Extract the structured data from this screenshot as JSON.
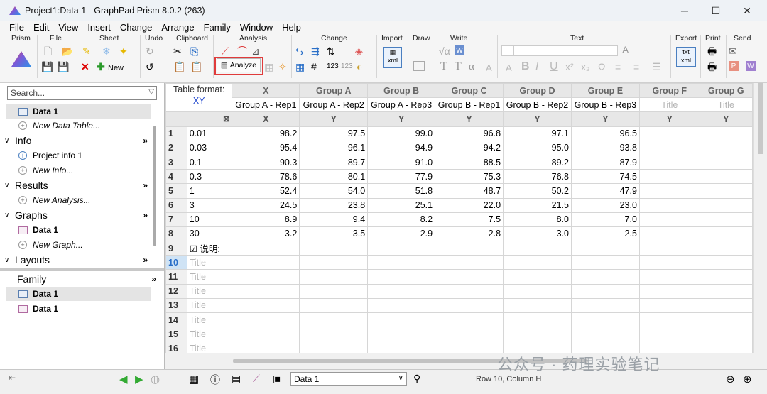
{
  "window": {
    "title": "Project1:Data 1 - GraphPad Prism 8.0.2 (263)",
    "minimize": "─",
    "restore": "☐",
    "close": "✕"
  },
  "menu": [
    "File",
    "Edit",
    "View",
    "Insert",
    "Change",
    "Arrange",
    "Family",
    "Window",
    "Help"
  ],
  "ribbon": {
    "groups": [
      "Prism",
      "File",
      "Sheet",
      "Undo",
      "Clipboard",
      "Analysis",
      "Change",
      "Import",
      "Draw",
      "Write",
      "Text",
      "Export",
      "Print",
      "Send"
    ],
    "new_label": "New",
    "analyze_label": "Analyze"
  },
  "sidebar": {
    "search_placeholder": "Search...",
    "data_tables": [
      {
        "label": "Data 1"
      },
      {
        "label": "New Data Table..."
      }
    ],
    "info": {
      "label": "Info",
      "items": [
        "Project info 1",
        "New Info..."
      ]
    },
    "results": {
      "label": "Results",
      "items": [
        "New Analysis..."
      ]
    },
    "graphs": {
      "label": "Graphs",
      "items": [
        "Data 1",
        "New Graph..."
      ]
    },
    "layouts": {
      "label": "Layouts"
    },
    "family": {
      "label": "Family",
      "items": [
        "Data 1",
        "Data 1"
      ]
    }
  },
  "table": {
    "format_label": "Table format:",
    "format_value": "XY",
    "columns": [
      {
        "letter": "X",
        "title": "Group A - Rep1",
        "sub": "X"
      },
      {
        "letter": "Group A",
        "title": "Group A - Rep2",
        "sub": "Y"
      },
      {
        "letter": "Group B",
        "title": "Group A - Rep3",
        "sub": "Y"
      },
      {
        "letter": "Group C",
        "title": "Group B - Rep1",
        "sub": "Y"
      },
      {
        "letter": "Group D",
        "title": "Group B - Rep2",
        "sub": "Y"
      },
      {
        "letter": "Group E",
        "title": "Group B - Rep3",
        "sub": "Y"
      },
      {
        "letter": "Group F",
        "title": "Title",
        "sub": "Y"
      },
      {
        "letter": "Group G",
        "title": "Title",
        "sub": "Y"
      }
    ],
    "rows": [
      {
        "n": "1",
        "label": "0.01",
        "values": [
          "98.2",
          "97.5",
          "99.0",
          "96.8",
          "97.1",
          "96.5"
        ]
      },
      {
        "n": "2",
        "label": "0.03",
        "values": [
          "95.4",
          "96.1",
          "94.9",
          "94.2",
          "95.0",
          "93.8"
        ]
      },
      {
        "n": "3",
        "label": "0.1",
        "values": [
          "90.3",
          "89.7",
          "91.0",
          "88.5",
          "89.2",
          "87.9"
        ]
      },
      {
        "n": "4",
        "label": "0.3",
        "values": [
          "78.6",
          "80.1",
          "77.9",
          "75.3",
          "76.8",
          "74.5"
        ]
      },
      {
        "n": "5",
        "label": "1",
        "values": [
          "52.4",
          "54.0",
          "51.8",
          "48.7",
          "50.2",
          "47.9"
        ]
      },
      {
        "n": "6",
        "label": "3",
        "values": [
          "24.5",
          "23.8",
          "25.1",
          "22.0",
          "21.5",
          "23.0"
        ]
      },
      {
        "n": "7",
        "label": "10",
        "values": [
          "8.9",
          "9.4",
          "8.2",
          "7.5",
          "8.0",
          "7.0"
        ]
      },
      {
        "n": "8",
        "label": "30",
        "values": [
          "3.2",
          "3.5",
          "2.9",
          "2.8",
          "3.0",
          "2.5"
        ]
      },
      {
        "n": "9",
        "label": "☑ 说明:",
        "values": []
      },
      {
        "n": "10",
        "label": "Title",
        "values": []
      },
      {
        "n": "11",
        "label": "Title",
        "values": []
      },
      {
        "n": "12",
        "label": "Title",
        "values": []
      },
      {
        "n": "13",
        "label": "Title",
        "values": []
      },
      {
        "n": "14",
        "label": "Title",
        "values": []
      },
      {
        "n": "15",
        "label": "Title",
        "values": []
      },
      {
        "n": "16",
        "label": "Title",
        "values": []
      }
    ]
  },
  "bottom": {
    "sheet": "Data 1",
    "status": "Row 10, Column H"
  },
  "watermark": "公众号 · 药理实验笔记",
  "colors": {
    "accent_red": "#e03b3b",
    "selected_row": "#cfe3f5"
  }
}
